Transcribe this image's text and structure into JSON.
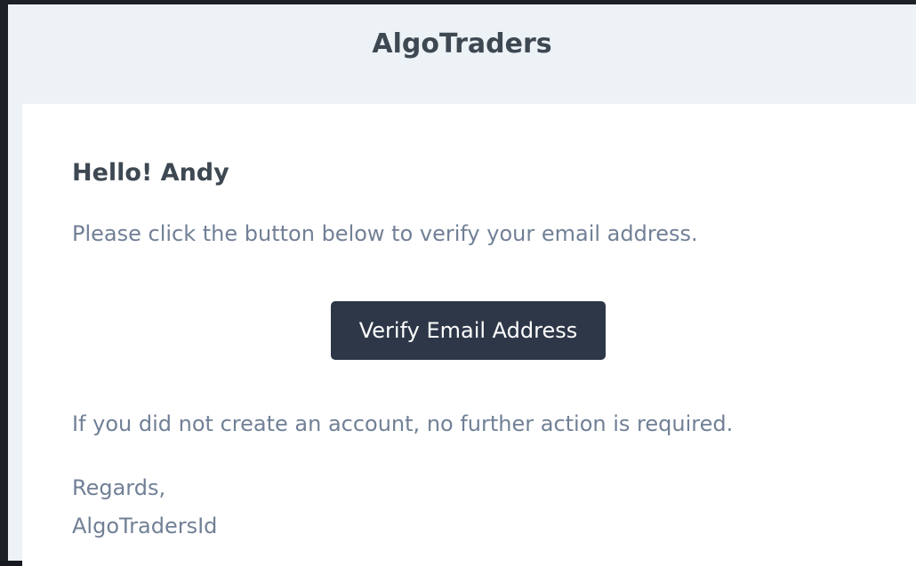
{
  "header": {
    "brand": "AlgoTraders"
  },
  "email": {
    "greeting": "Hello! Andy",
    "intro": "Please click the button below to verify your email address.",
    "button_label": "Verify Email Address",
    "outro": "If you did not create an account, no further action is required.",
    "salutation": "Regards,",
    "signature": "AlgoTradersId"
  },
  "colors": {
    "page_background": "#edf2f7",
    "card_background": "#ffffff",
    "button_background": "#2d3748",
    "heading_text": "#3d4852",
    "body_text": "#718096"
  }
}
